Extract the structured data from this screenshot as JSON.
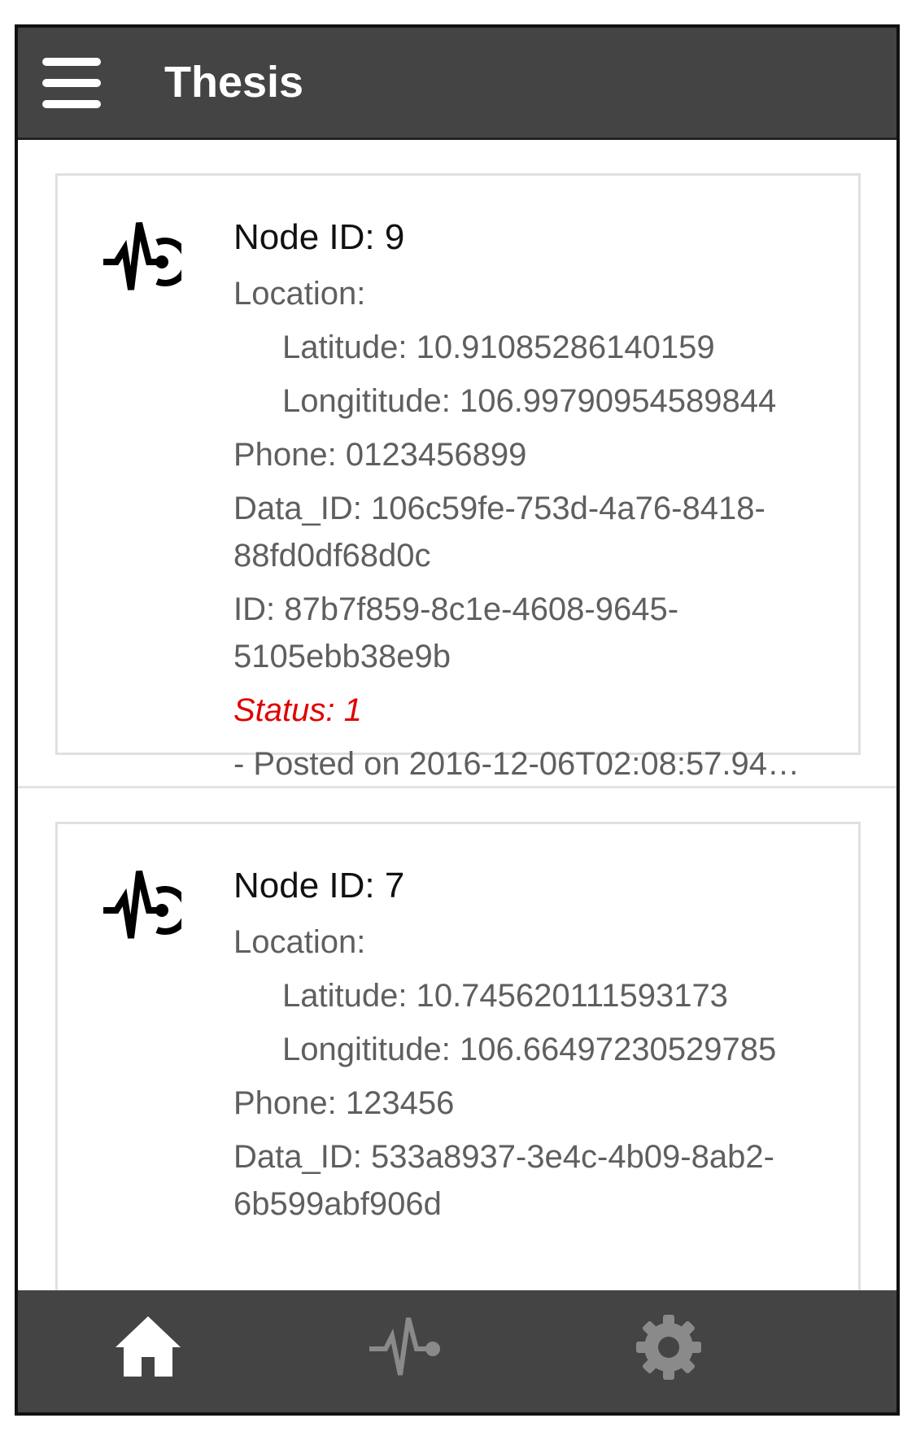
{
  "header": {
    "title": "Thesis",
    "menu_icon": "hamburger-menu-icon"
  },
  "nodes": [
    {
      "icon": "pulse-node-icon",
      "title": "Node ID: 9",
      "location_label": "Location:",
      "latitude": "Latitude: 10.91085286140159",
      "longitude": "Longititude: 106.99790954589844",
      "phone": "Phone: 0123456899",
      "data_id": "Data_ID: 106c59fe-753d-4a76-8418-88fd0df68d0c",
      "id": "ID: 87b7f859-8c1e-4608-9645-5105ebb38e9b",
      "status": "Status: 1",
      "posted": "- Posted on 2016-12-06T02:08:57.94…"
    },
    {
      "icon": "pulse-node-icon",
      "title": "Node ID: 7",
      "location_label": "Location:",
      "latitude": "Latitude: 10.745620111593173",
      "longitude": "Longititude: 106.66497230529785",
      "phone": "Phone: 123456",
      "data_id": "Data_ID: 533a8937-3e4c-4b09-8ab2-6b599abf906d"
    }
  ],
  "bottom_nav": [
    {
      "icon": "home-icon",
      "active": true
    },
    {
      "icon": "pulse-icon",
      "active": false
    },
    {
      "icon": "gear-icon",
      "active": false
    }
  ],
  "colors": {
    "bar": "#444444",
    "status": "#e00000",
    "active_tab": "#ffffff",
    "inactive_tab": "#8a8a8a"
  }
}
